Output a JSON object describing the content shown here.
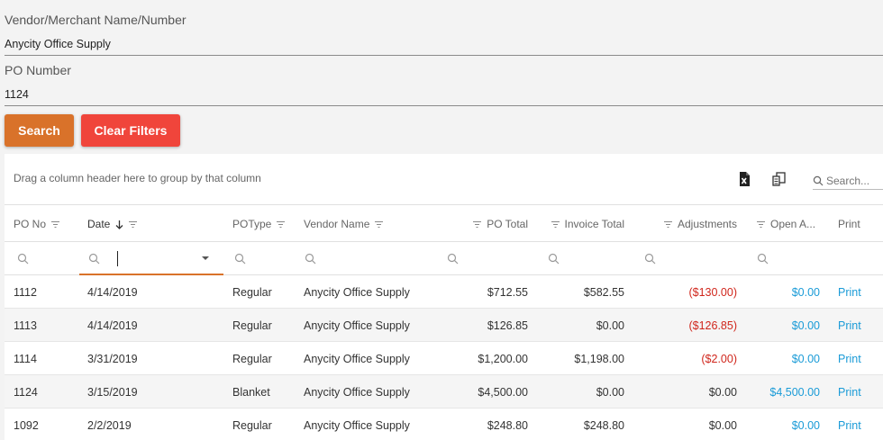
{
  "filters": {
    "vendor": {
      "label": "Vendor/Merchant Name/Number",
      "value": "Anycity Office Supply"
    },
    "po": {
      "label": "PO Number",
      "value": "1124"
    }
  },
  "buttons": {
    "search": "Search",
    "clear": "Clear Filters"
  },
  "grid": {
    "group_hint": "Drag a column header here to group by that column",
    "search_placeholder": "Search...",
    "columns": {
      "po_no": "PO No",
      "date": "Date",
      "potype": "POType",
      "vendor": "Vendor Name",
      "po_total": "PO Total",
      "invoice_total": "Invoice Total",
      "adjustments": "Adjustments",
      "open": "Open A...",
      "print": "Print"
    },
    "rows": [
      {
        "po_no": "1112",
        "date": "4/14/2019",
        "potype": "Regular",
        "vendor": "Anycity Office Supply",
        "po_total": "$712.55",
        "invoice_total": "$582.55",
        "adjustments": "($130.00)",
        "open": "$0.00",
        "print": "Print"
      },
      {
        "po_no": "1113",
        "date": "4/14/2019",
        "potype": "Regular",
        "vendor": "Anycity Office Supply",
        "po_total": "$126.85",
        "invoice_total": "$0.00",
        "adjustments": "($126.85)",
        "open": "$0.00",
        "print": "Print"
      },
      {
        "po_no": "1114",
        "date": "3/31/2019",
        "potype": "Regular",
        "vendor": "Anycity Office Supply",
        "po_total": "$1,200.00",
        "invoice_total": "$1,198.00",
        "adjustments": "($2.00)",
        "open": "$0.00",
        "print": "Print"
      },
      {
        "po_no": "1124",
        "date": "3/15/2019",
        "potype": "Blanket",
        "vendor": "Anycity Office Supply",
        "po_total": "$4,500.00",
        "invoice_total": "$0.00",
        "adjustments": "$0.00",
        "open": "$4,500.00",
        "print": "Print"
      },
      {
        "po_no": "1092",
        "date": "2/2/2019",
        "potype": "Regular",
        "vendor": "Anycity Office Supply",
        "po_total": "$248.80",
        "invoice_total": "$248.80",
        "adjustments": "$0.00",
        "open": "$0.00",
        "print": "Print"
      }
    ]
  },
  "colors": {
    "search": "#d9722a",
    "clear": "#f0453b",
    "negative": "#d0261c",
    "link": "#1a9bd7"
  }
}
